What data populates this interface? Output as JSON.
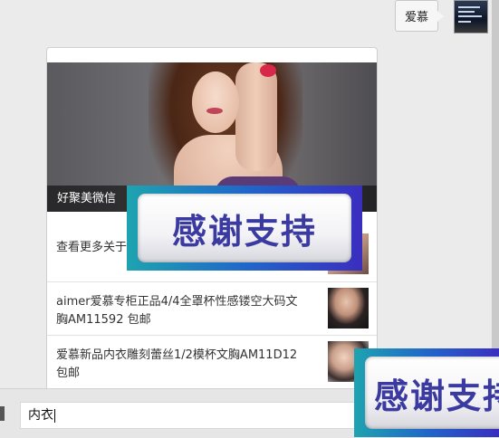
{
  "chat": {
    "outgoing_message": "爱慕"
  },
  "news_card": {
    "hero_caption": "好聚美微信",
    "items": [
      {
        "text": "查看更多关于"
      },
      {
        "text": "aimer爱慕专柜正品4/4全罩杯性感镂空大码文\n胸AM11592 包邮"
      },
      {
        "text": "爱慕新品内衣雕刻蕾丝1/2模杯文胸AM11D12\n包邮"
      }
    ]
  },
  "stickers": {
    "text": "感谢支持"
  },
  "input": {
    "value": "内衣"
  }
}
